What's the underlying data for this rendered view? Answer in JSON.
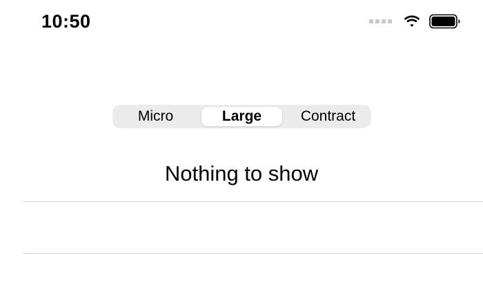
{
  "status_bar": {
    "time": "10:50",
    "icons": [
      "cellular-signal-icon",
      "wifi-icon",
      "battery-icon"
    ]
  },
  "segmented_control": {
    "segments": [
      {
        "label": "Micro"
      },
      {
        "label": "Large"
      },
      {
        "label": "Contract"
      }
    ],
    "selected": "Large"
  },
  "content": {
    "empty_message": "Nothing to show"
  }
}
